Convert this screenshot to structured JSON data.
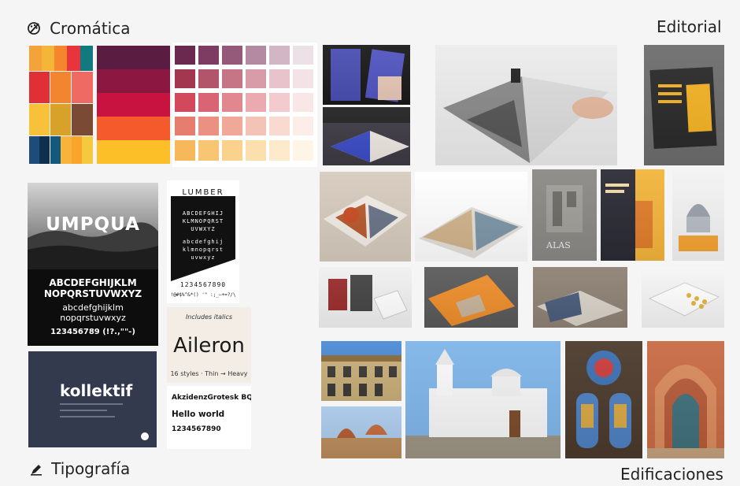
{
  "labels": {
    "cromatica": "Cromática",
    "editorial": "Editorial",
    "tipografia": "Tipografía",
    "edificaciones": "Edificaciones"
  },
  "icons": {
    "cromatica": "palette-icon",
    "tipografia": "pen-icon"
  },
  "typography": {
    "umpqua": {
      "title": "UMPQUA",
      "upper1": "ABCDEFGHIJKLM",
      "upper2": "NOPQRSTUVWXYZ",
      "lower1": "abcdefghijklm",
      "lower2": "nopqrstuvwxyz",
      "digits": "123456789 (!?.,\"\"-)"
    },
    "lumber": {
      "title": "LUMBER",
      "upper1": "ABCDEFGHIJ",
      "upper2": "KLMNOPQRST",
      "upper3": "UVWXYZ",
      "lower1": "abcdefghij",
      "lower2": "klmnopqrst",
      "lower3": "uvwxyz",
      "digits": "1234567890",
      "symbols": "!@#$%^&*() '\" :;_—+=?/\\"
    },
    "aileron": {
      "note": "Includes italics",
      "title": "Aileron",
      "styles": "16 styles · Thin → Heavy"
    },
    "akzidenz": {
      "name": "AkzidenzGrotesk BQ",
      "sample": "Hello world",
      "digits": "1234567890"
    },
    "kollektif": {
      "title": "kollektif"
    }
  },
  "colors": {
    "palette_a": [
      [
        "#f4a23a",
        "#f4b638",
        "#f5862e",
        "#e8343c",
        "#127a7f"
      ],
      [
        "#e02f36",
        "#f2852f",
        "#f06a64"
      ],
      [
        "#f7c23a",
        "#d8a22a",
        "#7b4a35"
      ],
      [
        "#1e4c79",
        "#0f2f4f",
        "#f7b33a",
        "#f4c93f"
      ]
    ],
    "palette_b": [
      "#5a1c40",
      "#8c1842",
      "#c8123f",
      "#f45a2c",
      "#fdbf28",
      "#fdce3c"
    ],
    "palette_c_columns": [
      "#6b2950",
      "#8e4665",
      "#b27088",
      "#cc97aa",
      "#e0bccb",
      "#f0e4ec"
    ],
    "palette_c_rows": [
      "#6b2950",
      "#a3374f",
      "#d2495c",
      "#e67d6e",
      "#f6b85a"
    ]
  }
}
